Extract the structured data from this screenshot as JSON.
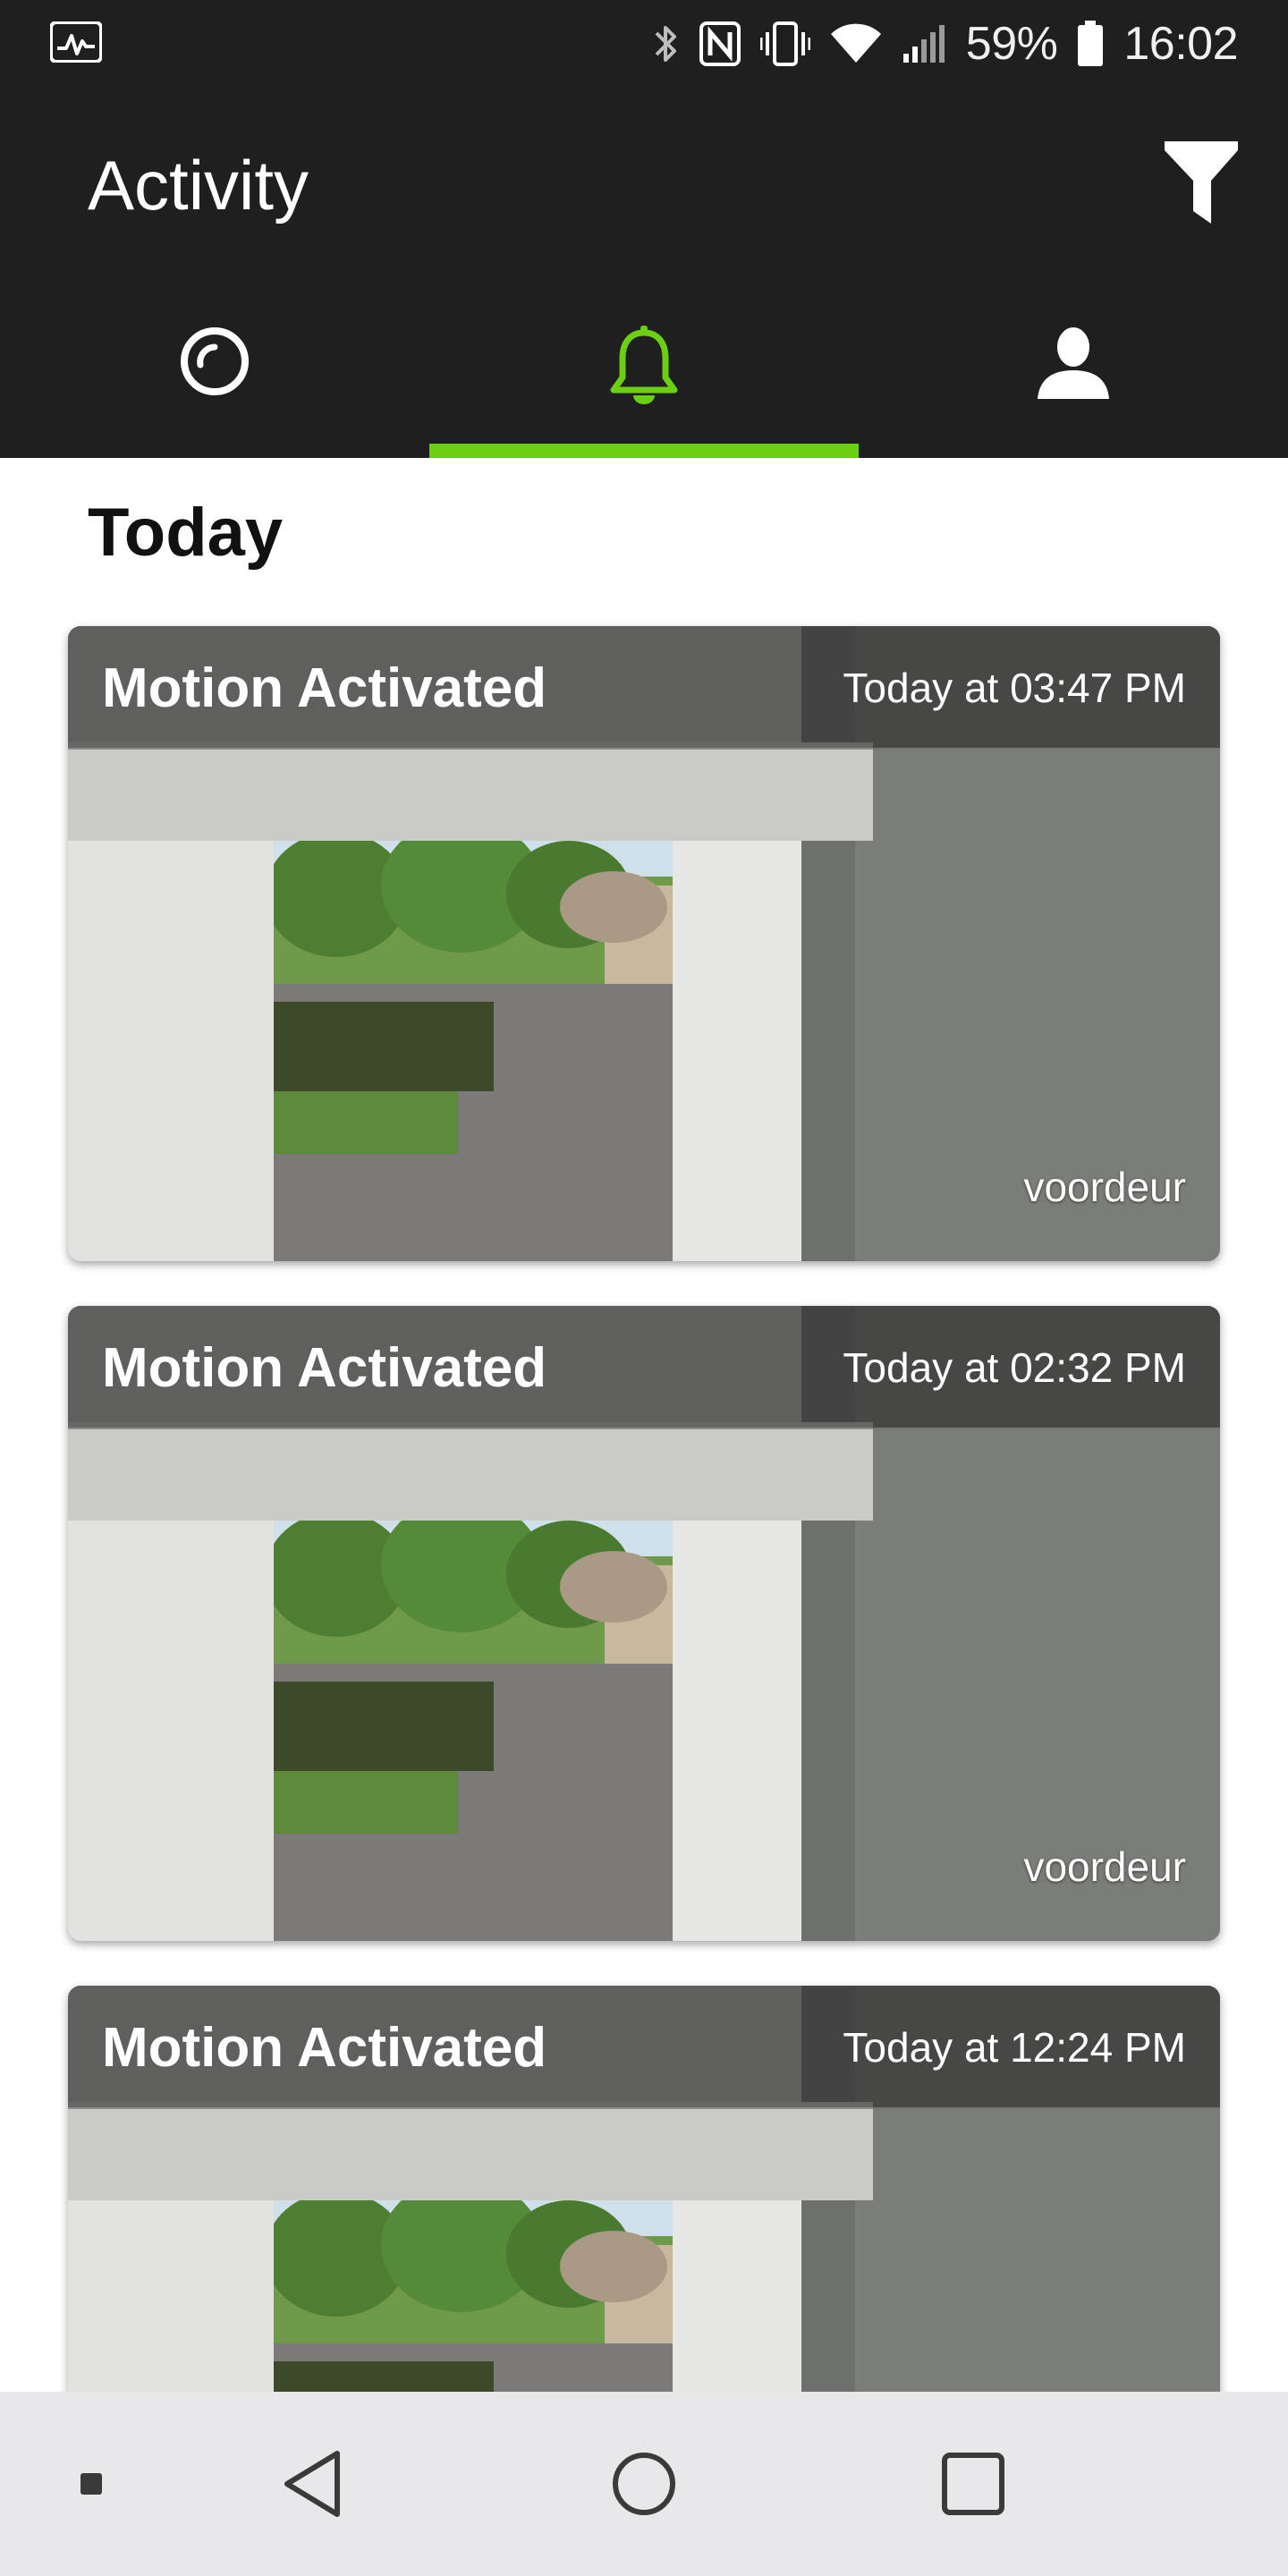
{
  "status_bar": {
    "left_icon": "activity-pulse-icon",
    "icons": [
      "bluetooth-icon",
      "nfc-icon",
      "vibrate-icon",
      "wifi-icon",
      "signal-icon"
    ],
    "battery_percent": "59%",
    "battery_icon": "battery-icon",
    "clock": "16:02"
  },
  "header": {
    "title": "Activity",
    "filter_icon": "filter-icon"
  },
  "tabs": [
    {
      "icon": "camera-lens-icon",
      "active": false
    },
    {
      "icon": "bell-icon",
      "active": true
    },
    {
      "icon": "person-icon",
      "active": false
    }
  ],
  "colors": {
    "accent": "#6ccf10",
    "header_bg": "#1f1f1f",
    "nav_bg": "#e8e8ea"
  },
  "section": {
    "title": "Today"
  },
  "events": [
    {
      "title": "Motion Activated",
      "time": "Today at 03:47 PM",
      "camera": "voordeur"
    },
    {
      "title": "Motion Activated",
      "time": "Today at 02:32 PM",
      "camera": "voordeur"
    },
    {
      "title": "Motion Activated",
      "time": "Today at 12:24 PM",
      "camera": ""
    }
  ],
  "nav_bar": {
    "buttons": [
      "menu-dot-icon",
      "back-icon",
      "home-icon",
      "recents-icon"
    ]
  }
}
